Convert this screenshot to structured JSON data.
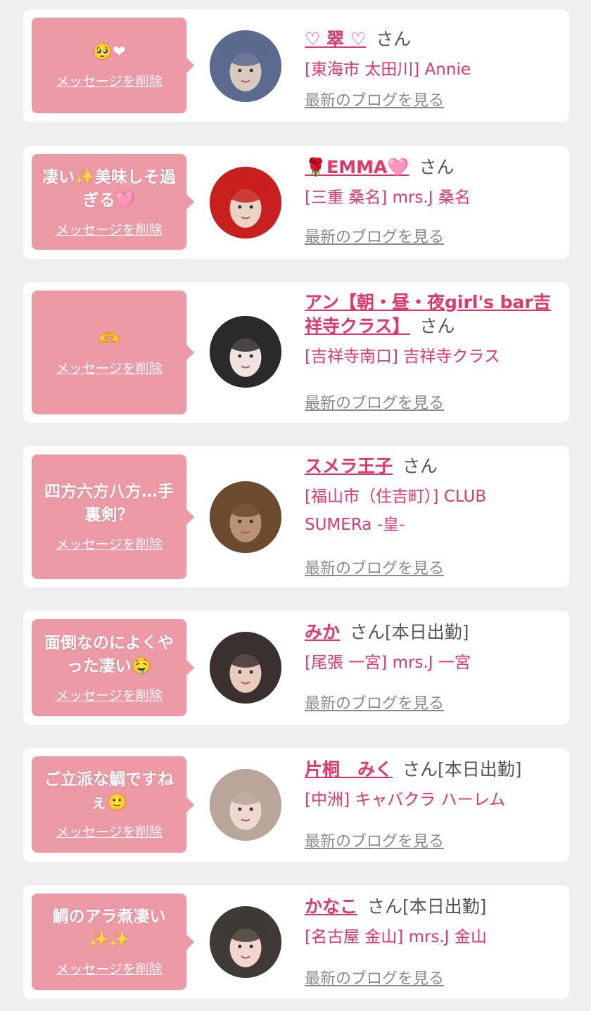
{
  "delete_label": "メッセージを削除",
  "blog_label": "最新のブログを見る",
  "colors": {
    "bubble": "#ec9aa6",
    "name": "#e0386a",
    "link_gray": "#8a8a8a",
    "background": "#efefef"
  },
  "cards": [
    {
      "message": "🥺❤",
      "name": "♡ 翠 ♡",
      "suffix": "さん",
      "shop": "[東海市 太田川] Annie",
      "avatar_colors": [
        "#5b6a8f",
        "#d9c9be"
      ]
    },
    {
      "message": "凄い✨美味しそ過ぎる🩷",
      "name": "🌹EMMA🩷",
      "suffix": "さん",
      "shop": "[三重 桑名] mrs.J 桑名",
      "avatar_colors": [
        "#c8201e",
        "#e9d4c4"
      ]
    },
    {
      "message": "🫶",
      "name": "アン【朝・昼・夜girl's bar吉祥寺クラス】",
      "suffix": "さん",
      "shop": "[吉祥寺南口] 吉祥寺クラス",
      "avatar_colors": [
        "#2a2a2a",
        "#f1e3df"
      ]
    },
    {
      "message": "四方六方八方…手裏剣？",
      "name": "スメラ王子",
      "suffix": "さん",
      "shop": "[福山市（住吉町）] CLUB SUMERa -皇-",
      "avatar_colors": [
        "#6b4a2e",
        "#b89272"
      ]
    },
    {
      "message": "面倒なのによくやった凄い🤤",
      "name": "みか",
      "suffix": "さん[本日出勤]",
      "shop": "[尾張 一宮] mrs.J 一宮",
      "avatar_colors": [
        "#3b3030",
        "#e8cdbf"
      ]
    },
    {
      "message": "ご立派な鯛ですねぇ🙂",
      "name": "片桐　みく",
      "suffix": "さん[本日出勤]",
      "shop": "[中洲] キャバクラ ハーレム",
      "avatar_colors": [
        "#b9a59a",
        "#efd8cf"
      ]
    },
    {
      "message": "鯛のアラ煮凄い✨✨",
      "name": "かなこ",
      "suffix": "さん[本日出勤]",
      "shop": "[名古屋 金山] mrs.J 金山",
      "avatar_colors": [
        "#3f3a36",
        "#f0d6cc"
      ]
    }
  ]
}
